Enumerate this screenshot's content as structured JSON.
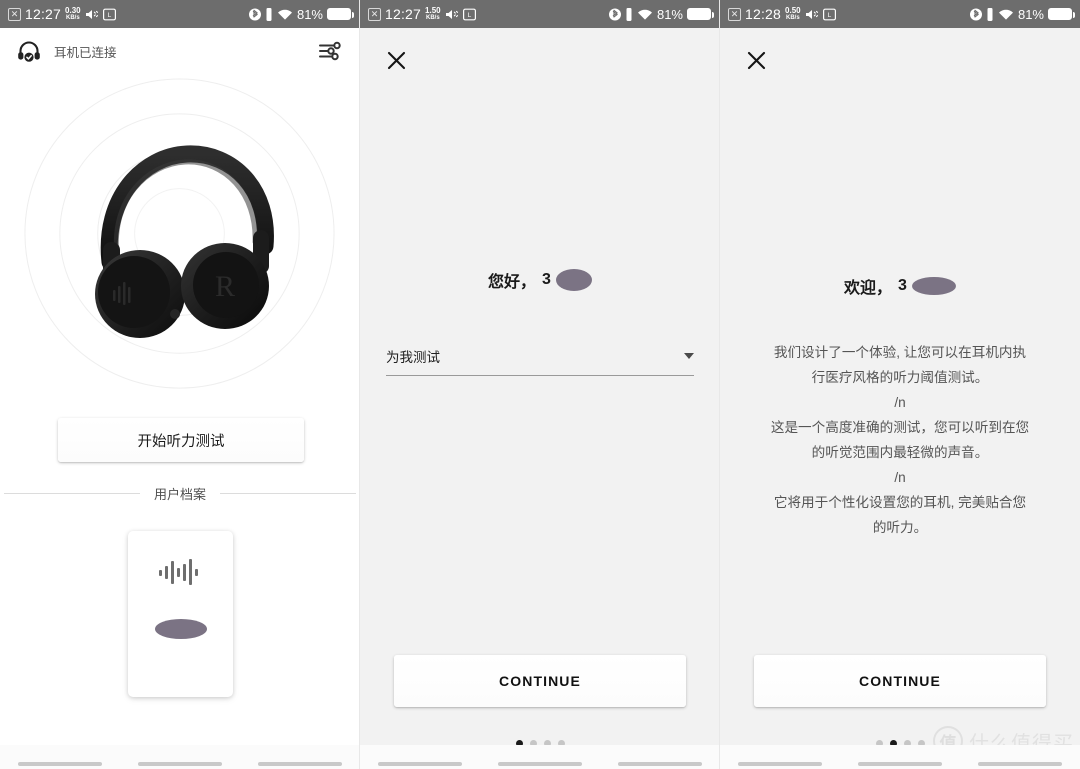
{
  "panels": [
    {
      "status_bar": {
        "time": "12:27",
        "net_speed_value": "0.30",
        "net_speed_unit": "KB/s",
        "battery_percent": "81%",
        "icons": [
          "sim-x-icon",
          "volume-mute-icon",
          "screenshot-icon",
          "bluetooth-icon",
          "vibrate-icon",
          "wifi-icon",
          "battery-icon"
        ]
      },
      "header": {
        "title": "耳机已连接",
        "left_icon": "headphone-connected-icon",
        "right_icon": "equalizer-tune-icon"
      },
      "hero": {
        "image": "black-over-ear-headphones",
        "marking": "R"
      },
      "start_test_label": "开始听力测试",
      "section_label": "用户档案",
      "profile_card": {
        "icon": "audio-waveform-icon",
        "name_redacted": ""
      },
      "nav_hints": 3
    },
    {
      "status_bar": {
        "time": "12:27",
        "net_speed_value": "1.50",
        "net_speed_unit": "KB/s",
        "battery_percent": "81%"
      },
      "close_icon": "close-icon",
      "greeting_prefix": "您好，",
      "greeting_partial": "3",
      "select": {
        "value": "为我测试",
        "caret": "chevron-down-icon"
      },
      "continue_label": "CONTINUE",
      "dots": {
        "count": 4,
        "active_index": 0
      }
    },
    {
      "status_bar": {
        "time": "12:28",
        "net_speed_value": "0.50",
        "net_speed_unit": "KB/s",
        "battery_percent": "81%"
      },
      "close_icon": "close-icon",
      "greeting_prefix": "欢迎，",
      "greeting_partial": "3",
      "body_lines": [
        "我们设计了一个体验, 让您可以在耳机内执",
        "行医疗风格的听力阈值测试。",
        "/n",
        "这是一个高度准确的测试，您可以听到在您",
        "的听觉范围内最轻微的声音。",
        "/n",
        "它将用于个性化设置您的耳机, 完美贴合您",
        "的听力。"
      ],
      "continue_label": "CONTINUE",
      "dots": {
        "count": 4,
        "active_index": 1
      },
      "watermark": {
        "logo_char": "值",
        "text": "什么值得买"
      }
    }
  ],
  "colors": {
    "statusbar_bg": "#6d6d6d",
    "panel_white": "#ffffff",
    "panel_gray": "#f2f2f2",
    "redaction": "#7b7384",
    "text_primary": "#1a1a1a",
    "text_secondary": "#555555"
  }
}
